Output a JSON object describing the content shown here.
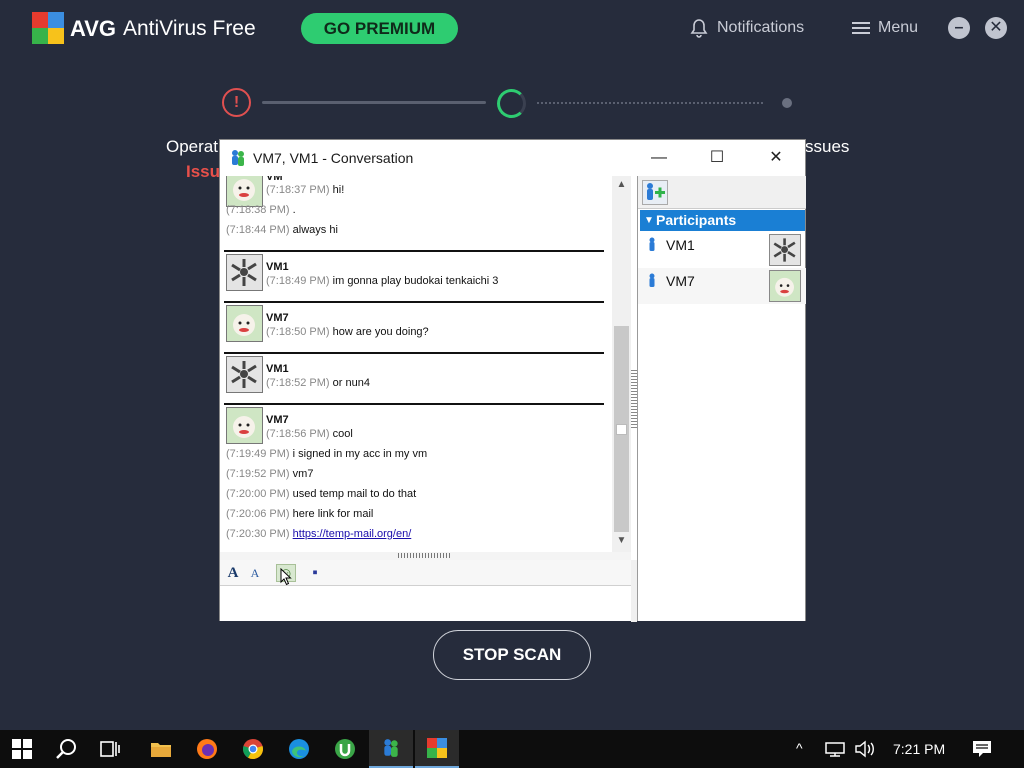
{
  "avg": {
    "brand": "AVG",
    "product": "AntiVirus Free",
    "premium_label": "GO PREMIUM",
    "notifications_label": "Notifications",
    "menu_label": "Menu",
    "minimize_symbol": "–",
    "close_symbol": "✕",
    "alert_symbol": "!",
    "left_text_1": "Operat",
    "left_text_2": "Issu",
    "right_text": "ssues",
    "stop_label": "STOP SCAN",
    "colors": {
      "bg": "#262c3c",
      "accent": "#2ecc71",
      "alert": "#e05050"
    }
  },
  "conversation": {
    "title": "VM7, VM1 - Conversation",
    "controls": {
      "minimize": "—",
      "maximize": "☐",
      "close": "✕"
    },
    "top_partial_name": "VM",
    "lines_top": [
      {
        "time": "(7:18:37 PM)",
        "text": "hi!"
      },
      {
        "time": "(7:18:38 PM)",
        "text": "."
      },
      {
        "time": "(7:18:44 PM)",
        "text": "always hi"
      }
    ],
    "messages": [
      {
        "sender": "VM1",
        "time": "(7:18:49 PM)",
        "text": "im gonna play  budokai tenkaichi 3",
        "avatar": "gear-avatar"
      },
      {
        "sender": "VM7",
        "time": "(7:18:50 PM)",
        "text": "how are you doing?",
        "avatar": "cat-avatar"
      },
      {
        "sender": "VM1",
        "time": "(7:18:52 PM)",
        "text": "or nun4",
        "avatar": "gear-avatar"
      },
      {
        "sender": "VM7",
        "time": "(7:18:56 PM)",
        "text": "cool",
        "avatar": "cat-avatar"
      }
    ],
    "lines_bottom": [
      {
        "time": "(7:19:49 PM)",
        "text": "i signed in my acc in my vm"
      },
      {
        "time": "(7:19:52 PM)",
        "text": "vm7"
      },
      {
        "time": "(7:20:00 PM)",
        "text": "used temp mail to do that"
      },
      {
        "time": "(7:20:06 PM)",
        "text": "here link for mail"
      }
    ],
    "link_line": {
      "time": "(7:20:30 PM)",
      "url": "https://temp-mail.org/en/"
    },
    "scroll": {
      "up": "▲",
      "down": "▼"
    },
    "format_toolbar": {
      "font": "A",
      "font_style": "A",
      "emoticon": "☺",
      "save": "▪"
    },
    "participants_header": "Participants",
    "participants_arrow": "▼",
    "participants": [
      {
        "name": "VM1",
        "avatar": "gear-avatar"
      },
      {
        "name": "VM7",
        "avatar": "cat-avatar"
      }
    ]
  },
  "taskbar": {
    "start": "start-icon",
    "apps": [
      "search-icon",
      "task-view-icon",
      "file-explorer-icon",
      "firefox-icon",
      "chrome-icon",
      "edge-icon",
      "utorrent-icon",
      "messenger-icon",
      "avg-icon"
    ],
    "tray_chevron": "^",
    "clock": "7:21 PM"
  }
}
